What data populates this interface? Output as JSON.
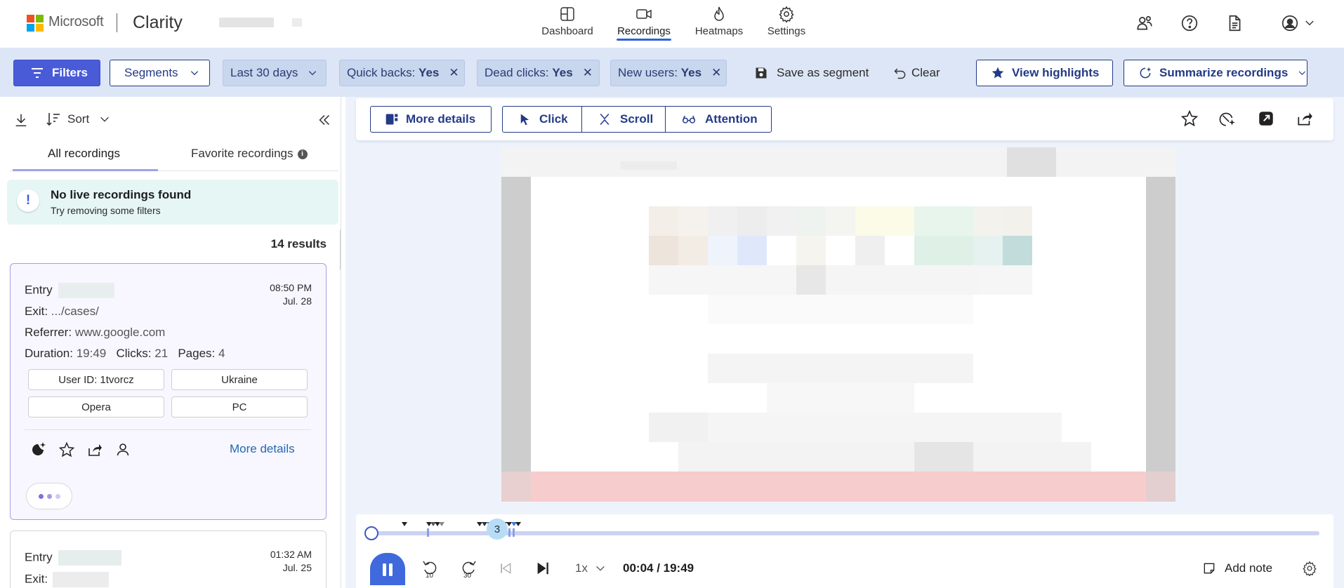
{
  "header": {
    "ms_label": "Microsoft",
    "app_name": "Clarity",
    "nav": [
      {
        "label": "Dashboard",
        "icon": "dashboard-icon"
      },
      {
        "label": "Recordings",
        "icon": "video-icon"
      },
      {
        "label": "Heatmaps",
        "icon": "flame-icon"
      },
      {
        "label": "Settings",
        "icon": "gear-icon"
      }
    ],
    "right_icons": [
      "people-icon",
      "help-icon",
      "document-icon",
      "account-icon"
    ]
  },
  "filters": {
    "filters_label": "Filters",
    "segments_label": "Segments",
    "date_range": "Last 30 days",
    "active": [
      {
        "name": "Quick backs:",
        "value": "Yes"
      },
      {
        "name": "Dead clicks:",
        "value": "Yes"
      },
      {
        "name": "New users:",
        "value": "Yes"
      }
    ],
    "save_segment": "Save as segment",
    "clear": "Clear",
    "view_highlights": "View highlights",
    "summarize": "Summarize recordings"
  },
  "sidebar": {
    "sort_label": "Sort",
    "tabs": [
      "All recordings",
      "Favorite recordings"
    ],
    "banner_title": "No live recordings found",
    "banner_sub": "Try removing some filters",
    "results": "14 results",
    "recordings": [
      {
        "entry_label": "Entry",
        "exit_label": "Exit:",
        "exit_value": ".../cases/",
        "referrer_label": "Referrer:",
        "referrer_value": "www.google.com",
        "duration_label": "Duration:",
        "duration_value": "19:49",
        "clicks_label": "Clicks:",
        "clicks_value": "21",
        "pages_label": "Pages:",
        "pages_value": "4",
        "time": "08:50 PM",
        "date": "Jul. 28",
        "tags": [
          "User ID: 1tvorcz",
          "Ukraine",
          "Opera",
          "PC"
        ],
        "more_details": "More details"
      },
      {
        "entry_label": "Entry",
        "exit_label": "Exit:",
        "time": "01:32 AM",
        "date": "Jul. 25"
      }
    ]
  },
  "player": {
    "more_details": "More details",
    "click": "Click",
    "scroll": "Scroll",
    "attention": "Attention",
    "toolbar_icons": [
      "star-icon",
      "sparkle-icon",
      "open-external-icon",
      "share-icon"
    ],
    "event_count": "3",
    "rewind_label": "10",
    "forward_label": "30",
    "speed": "1x",
    "time": "00:04 / 19:49",
    "add_note": "Add note",
    "progress": 0.003
  },
  "colors": {
    "accent": "#4a5bd8",
    "navy": "#233a86",
    "filterbar_bg": "#dde6f6",
    "link": "#2168b3"
  }
}
